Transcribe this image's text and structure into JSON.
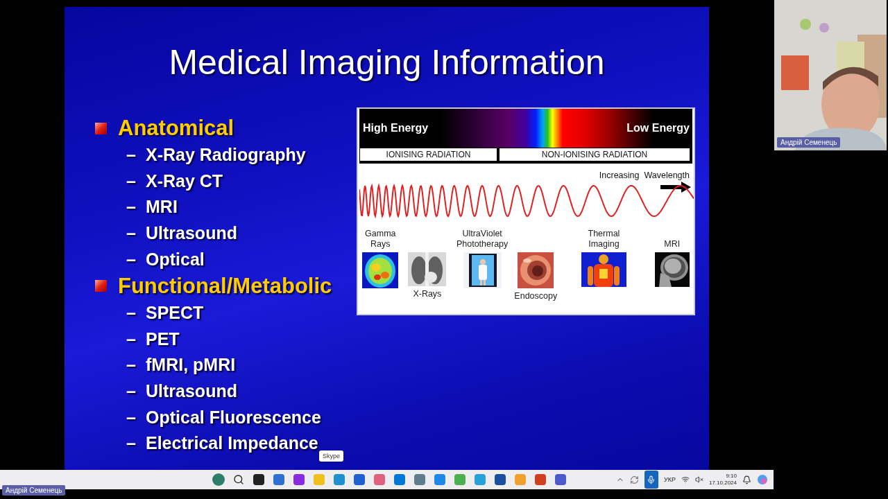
{
  "slide": {
    "title": "Medical Imaging Information",
    "sections": [
      {
        "heading": "Anatomical",
        "items": [
          {
            "marker": "–",
            "text": "X-Ray Radiography"
          },
          {
            "marker": "–",
            "text": "X-Ray CT"
          },
          {
            "marker": "–",
            "text": "MRI"
          },
          {
            "marker": "–",
            "text": "Ultrasound"
          },
          {
            "marker": "–",
            "text": "Optical"
          }
        ]
      },
      {
        "heading": "Functional/Metabolic",
        "items": [
          {
            "marker": "–",
            "text": "SPECT"
          },
          {
            "marker": "–",
            "text": "PET"
          },
          {
            "marker": "–",
            "text": "fMRI, pMRI"
          },
          {
            "marker": "–",
            "text": "Ultrasound"
          },
          {
            "marker": "–",
            "text": "Optical Fluorescence"
          },
          {
            "marker": "–",
            "text": "Electrical Impedance"
          }
        ]
      }
    ],
    "figure": {
      "high_label": "High Energy",
      "low_label": "Low Energy",
      "bands": [
        "IONISING RADIATION",
        "NON-IONISING RADIATION"
      ],
      "wavelength_label": "Increasing  Wavelength",
      "images": [
        {
          "caption": "Gamma\nRays",
          "kind": "above"
        },
        {
          "caption": "X-Rays",
          "kind": "below"
        },
        {
          "caption": "UltraViolet\nPhototherapy",
          "kind": "above"
        },
        {
          "caption": "Endoscopy",
          "kind": "below"
        },
        {
          "caption": "Thermal\nImaging",
          "kind": "above"
        },
        {
          "caption": "MRI",
          "kind": "above"
        }
      ]
    }
  },
  "tooltip": "Skype",
  "tray": {
    "language": "УКР",
    "time": "9:10",
    "date": "17.10.2024"
  },
  "webcam": {
    "name": "Андрій Семенець"
  },
  "presenter_badge": "Андрій Семенець"
}
